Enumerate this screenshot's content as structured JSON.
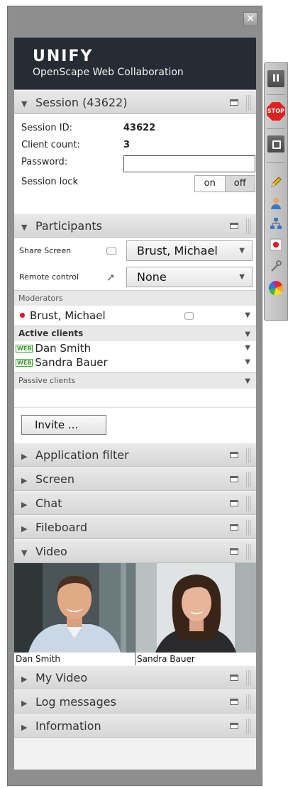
{
  "window": {
    "close_symbol": "✕"
  },
  "brand": {
    "logo": "UNIFY",
    "product": "OpenScape Web Collaboration"
  },
  "session": {
    "header": "Session (43622)",
    "id_label": "Session ID:",
    "id_value": "43622",
    "count_label": "Client count:",
    "count_value": "3",
    "password_label": "Password:",
    "password_value": "",
    "lock_label": "Session lock",
    "lock_on": "on",
    "lock_off": "off",
    "lock_state": "off"
  },
  "participants": {
    "header": "Participants",
    "share_label": "Share Screen",
    "share_value": "Brust, Michael",
    "remote_label": "Remote control",
    "remote_value": "None",
    "moderators_label": "Moderators",
    "moderators": [
      {
        "name": "Brust, Michael",
        "status_color": "#e0142a"
      }
    ],
    "active_label": "Active clients",
    "active": [
      {
        "tag": "WEB",
        "name": "Dan Smith"
      },
      {
        "tag": "WEB",
        "name": "Sandra Bauer"
      }
    ],
    "passive_label": "Passive clients",
    "invite_label": "Invite ..."
  },
  "sections": {
    "app_filter": "Application filter",
    "screen": "Screen",
    "chat": "Chat",
    "fileboard": "Fileboard",
    "video": "Video",
    "my_video": "My Video",
    "log": "Log messages",
    "info": "Information"
  },
  "video": {
    "tiles": [
      {
        "name": "Dan Smith"
      },
      {
        "name": "Sandra Bauer"
      }
    ]
  },
  "sidebar": {
    "buttons": [
      "pause-icon",
      "stop-icon",
      "square-icon",
      "pencil-icon",
      "person-icon",
      "network-icon",
      "record-icon",
      "tools-icon",
      "color-wheel-icon"
    ],
    "stop_label": "STOP",
    "pause_symbol": "II"
  },
  "colors": {
    "brand_bg": "#262c33",
    "record": "#e0142a",
    "web_tag": "#3a9a2a"
  }
}
